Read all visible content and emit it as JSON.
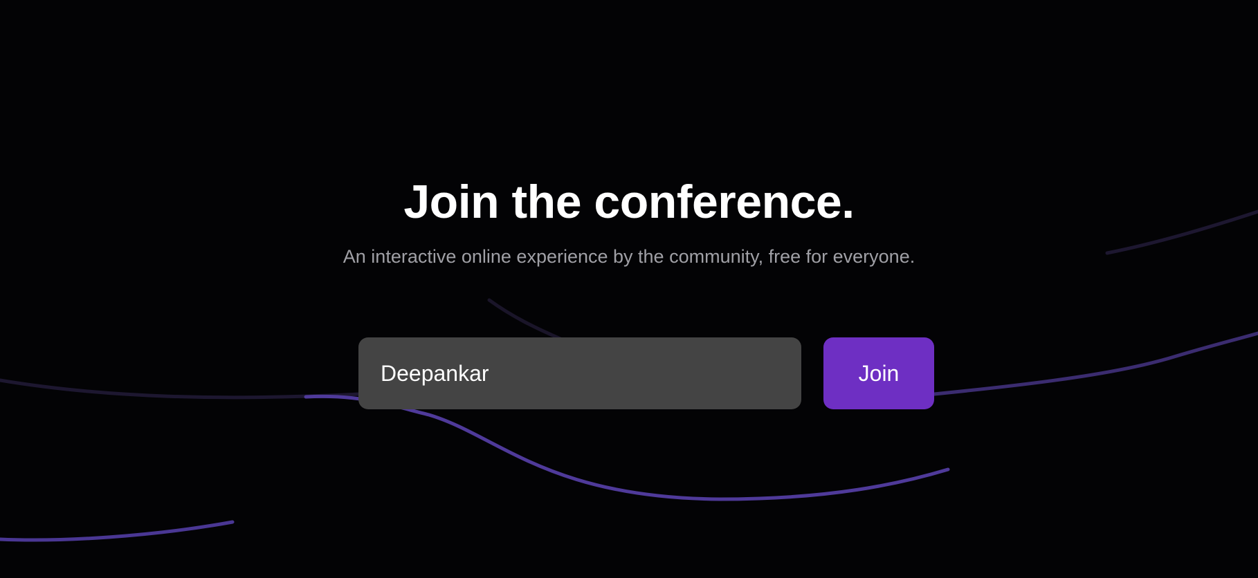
{
  "hero": {
    "title": "Join the conference.",
    "subtitle": "An interactive online experience by the community, free for everyone."
  },
  "form": {
    "name_value": "Deepankar",
    "join_label": "Join"
  },
  "colors": {
    "background": "#030305",
    "accent": "#6e2fc3",
    "input_background": "#444444",
    "line_bright": "#4f3a9a",
    "line_dim": "#1d1730"
  }
}
